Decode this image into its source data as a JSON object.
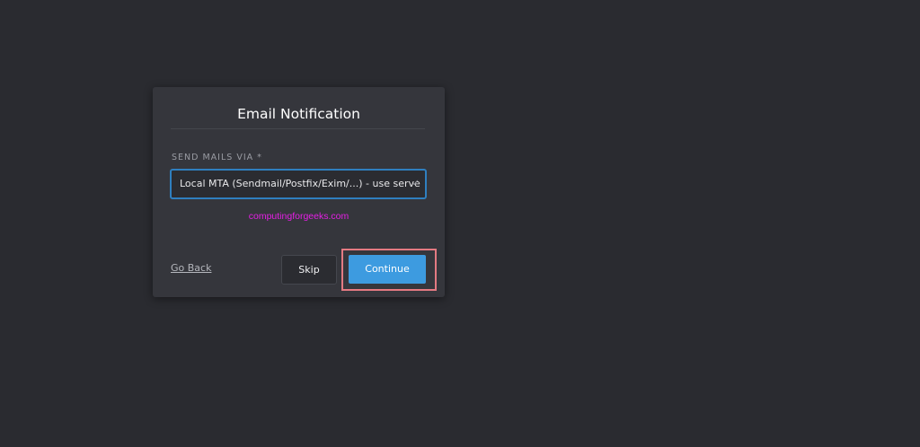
{
  "dialog": {
    "title": "Email Notification",
    "field_label": "SEND MAILS VIA *",
    "select_value": "Local MTA (Sendmail/Postfix/Exim/...) - use serve",
    "select_chevron": "chevron-down-icon",
    "watermark": "computingforgeeks.com",
    "go_back_label": "Go Back",
    "skip_label": "Skip",
    "continue_label": "Continue"
  },
  "colors": {
    "background": "#2a2b30",
    "dialog": "#35363c",
    "accent": "#3d9be0",
    "focus_border": "#2f7fbf",
    "highlight_box": "#e47a82",
    "watermark": "#e51fe5"
  }
}
